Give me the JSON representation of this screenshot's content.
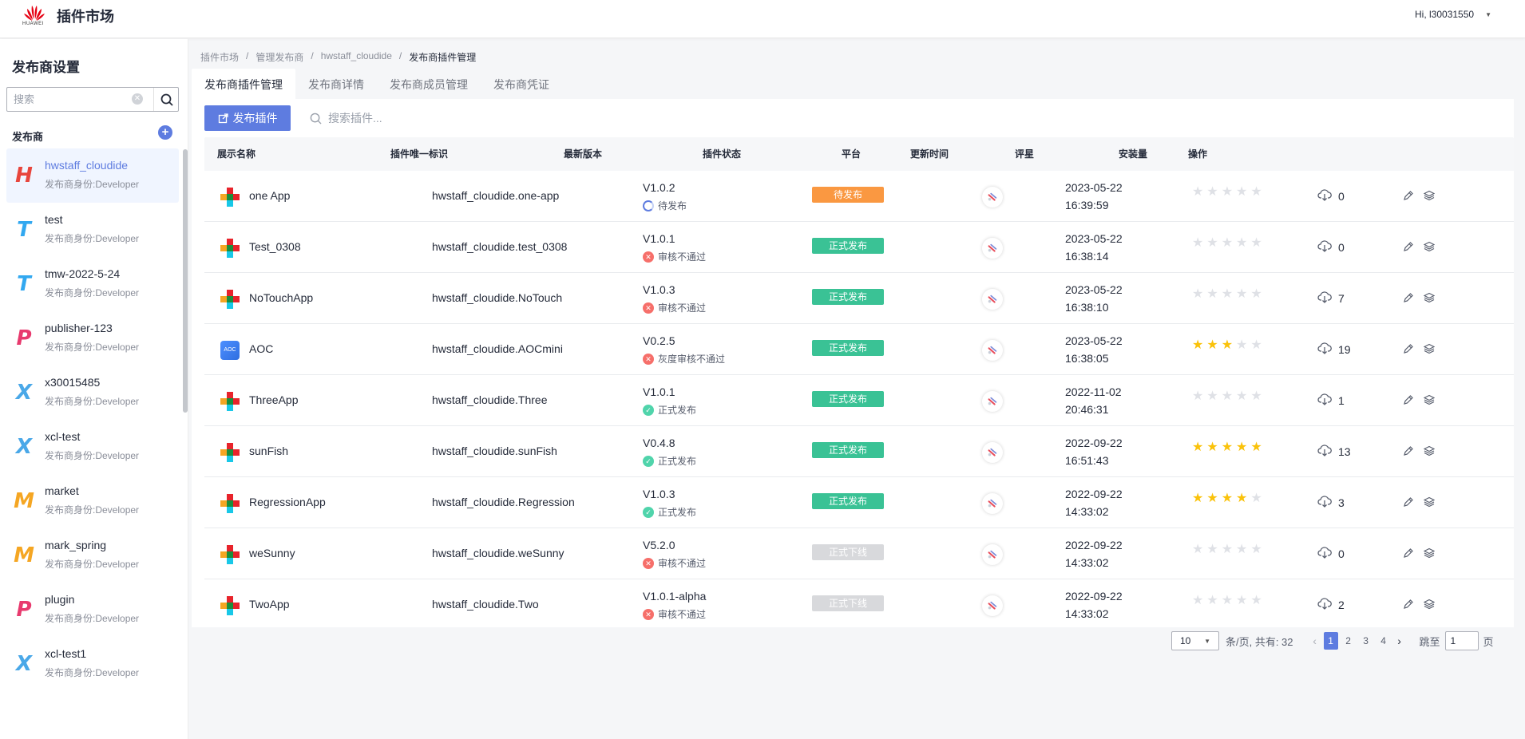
{
  "header": {
    "brand_sub": "HUAWEI",
    "title": "插件市场",
    "user": "Hi, l30031550"
  },
  "sidebar": {
    "title": "发布商设置",
    "search_placeholder": "搜索",
    "section": "发布商",
    "publishers": [
      {
        "name": "hwstaff_cloudide",
        "role": "发布商身份:Developer",
        "glyph": "H",
        "color": "#e8453c"
      },
      {
        "name": "test",
        "role": "发布商身份:Developer",
        "glyph": "T",
        "color": "#32a8f0"
      },
      {
        "name": "tmw-2022-5-24",
        "role": "发布商身份:Developer",
        "glyph": "T",
        "color": "#32a8f0"
      },
      {
        "name": "publisher-123",
        "role": "发布商身份:Developer",
        "glyph": "P",
        "color": "#e83a6e"
      },
      {
        "name": "x30015485",
        "role": "发布商身份:Developer",
        "glyph": "X",
        "color": "#4aa8e8"
      },
      {
        "name": "xcl-test",
        "role": "发布商身份:Developer",
        "glyph": "X",
        "color": "#4aa8e8"
      },
      {
        "name": "market",
        "role": "发布商身份:Developer",
        "glyph": "M",
        "color": "#f5a623"
      },
      {
        "name": "mark_spring",
        "role": "发布商身份:Developer",
        "glyph": "M",
        "color": "#f5a623"
      },
      {
        "name": "plugin",
        "role": "发布商身份:Developer",
        "glyph": "P",
        "color": "#e83a6e"
      },
      {
        "name": "xcl-test1",
        "role": "发布商身份:Developer",
        "glyph": "X",
        "color": "#4aa8e8"
      }
    ]
  },
  "breadcrumb": [
    "插件市场",
    "管理发布商",
    "hwstaff_cloudide",
    "发布商插件管理"
  ],
  "tabs": [
    "发布商插件管理",
    "发布商详情",
    "发布商成员管理",
    "发布商凭证"
  ],
  "toolbar": {
    "publish_label": "发布插件",
    "filter_placeholder": "搜索插件..."
  },
  "table": {
    "headers": [
      "展示名称",
      "插件唯一标识",
      "最新版本",
      "插件状态",
      "平台",
      "更新时间",
      "评星",
      "安装量",
      "操作"
    ],
    "rows": [
      {
        "name": "one App",
        "id": "hwstaff_cloudide.one-app",
        "version": "V1.0.2",
        "vstatus": "待发布",
        "vkind": "pend",
        "status": "待发布",
        "skind": "orange",
        "date": "2023-05-22",
        "time": "16:39:59",
        "stars": 0,
        "installs": "0",
        "icon": "cross"
      },
      {
        "name": "Test_0308",
        "id": "hwstaff_cloudide.test_0308",
        "version": "V1.0.1",
        "vstatus": "审核不通过",
        "vkind": "err",
        "status": "正式发布",
        "skind": "green",
        "date": "2023-05-22",
        "time": "16:38:14",
        "stars": 0,
        "installs": "0",
        "icon": "cross"
      },
      {
        "name": "NoTouchApp",
        "id": "hwstaff_cloudide.NoTouch",
        "version": "V1.0.3",
        "vstatus": "审核不通过",
        "vkind": "err",
        "status": "正式发布",
        "skind": "green",
        "date": "2023-05-22",
        "time": "16:38:10",
        "stars": 0,
        "installs": "7",
        "icon": "cross"
      },
      {
        "name": "AOC",
        "id": "hwstaff_cloudide.AOCmini",
        "version": "V0.2.5",
        "vstatus": "灰度审核不通过",
        "vkind": "err",
        "status": "正式发布",
        "skind": "green",
        "date": "2023-05-22",
        "time": "16:38:05",
        "stars": 3,
        "installs": "19",
        "icon": "aoc",
        "icon_label": "AOC"
      },
      {
        "name": "ThreeApp",
        "id": "hwstaff_cloudide.Three",
        "version": "V1.0.1",
        "vstatus": "正式发布",
        "vkind": "ok",
        "status": "正式发布",
        "skind": "green",
        "date": "2022-11-02",
        "time": "20:46:31",
        "stars": 0,
        "installs": "1",
        "icon": "cross"
      },
      {
        "name": "sunFish",
        "id": "hwstaff_cloudide.sunFish",
        "version": "V0.4.8",
        "vstatus": "正式发布",
        "vkind": "ok",
        "status": "正式发布",
        "skind": "green",
        "date": "2022-09-22",
        "time": "16:51:43",
        "stars": 5,
        "installs": "13",
        "icon": "cross"
      },
      {
        "name": "RegressionApp",
        "id": "hwstaff_cloudide.Regression",
        "version": "V1.0.3",
        "vstatus": "正式发布",
        "vkind": "ok",
        "status": "正式发布",
        "skind": "green",
        "date": "2022-09-22",
        "time": "14:33:02",
        "stars": 4,
        "installs": "3",
        "icon": "cross"
      },
      {
        "name": "weSunny",
        "id": "hwstaff_cloudide.weSunny",
        "version": "V5.2.0",
        "vstatus": "审核不通过",
        "vkind": "err",
        "status": "正式下线",
        "skind": "gray",
        "date": "2022-09-22",
        "time": "14:33:02",
        "stars": 0,
        "installs": "0",
        "icon": "cross"
      },
      {
        "name": "TwoApp",
        "id": "hwstaff_cloudide.Two",
        "version": "V1.0.1-alpha",
        "vstatus": "审核不通过",
        "vkind": "err",
        "status": "正式下线",
        "skind": "gray",
        "date": "2022-09-22",
        "time": "14:33:02",
        "stars": 0,
        "installs": "2",
        "icon": "cross"
      }
    ]
  },
  "pagination": {
    "page_size": "10",
    "total_text": "条/页, 共有: 32",
    "pages": [
      "1",
      "2",
      "3",
      "4"
    ],
    "current": "1",
    "jump_label": "跳至",
    "jump_value": "1",
    "page_unit": "页"
  },
  "colors": {
    "primary": "#5e7ce0",
    "pending": "#fa9841",
    "published": "#3ac295",
    "offline": "#d8d9dc",
    "star": "#fac20a"
  }
}
